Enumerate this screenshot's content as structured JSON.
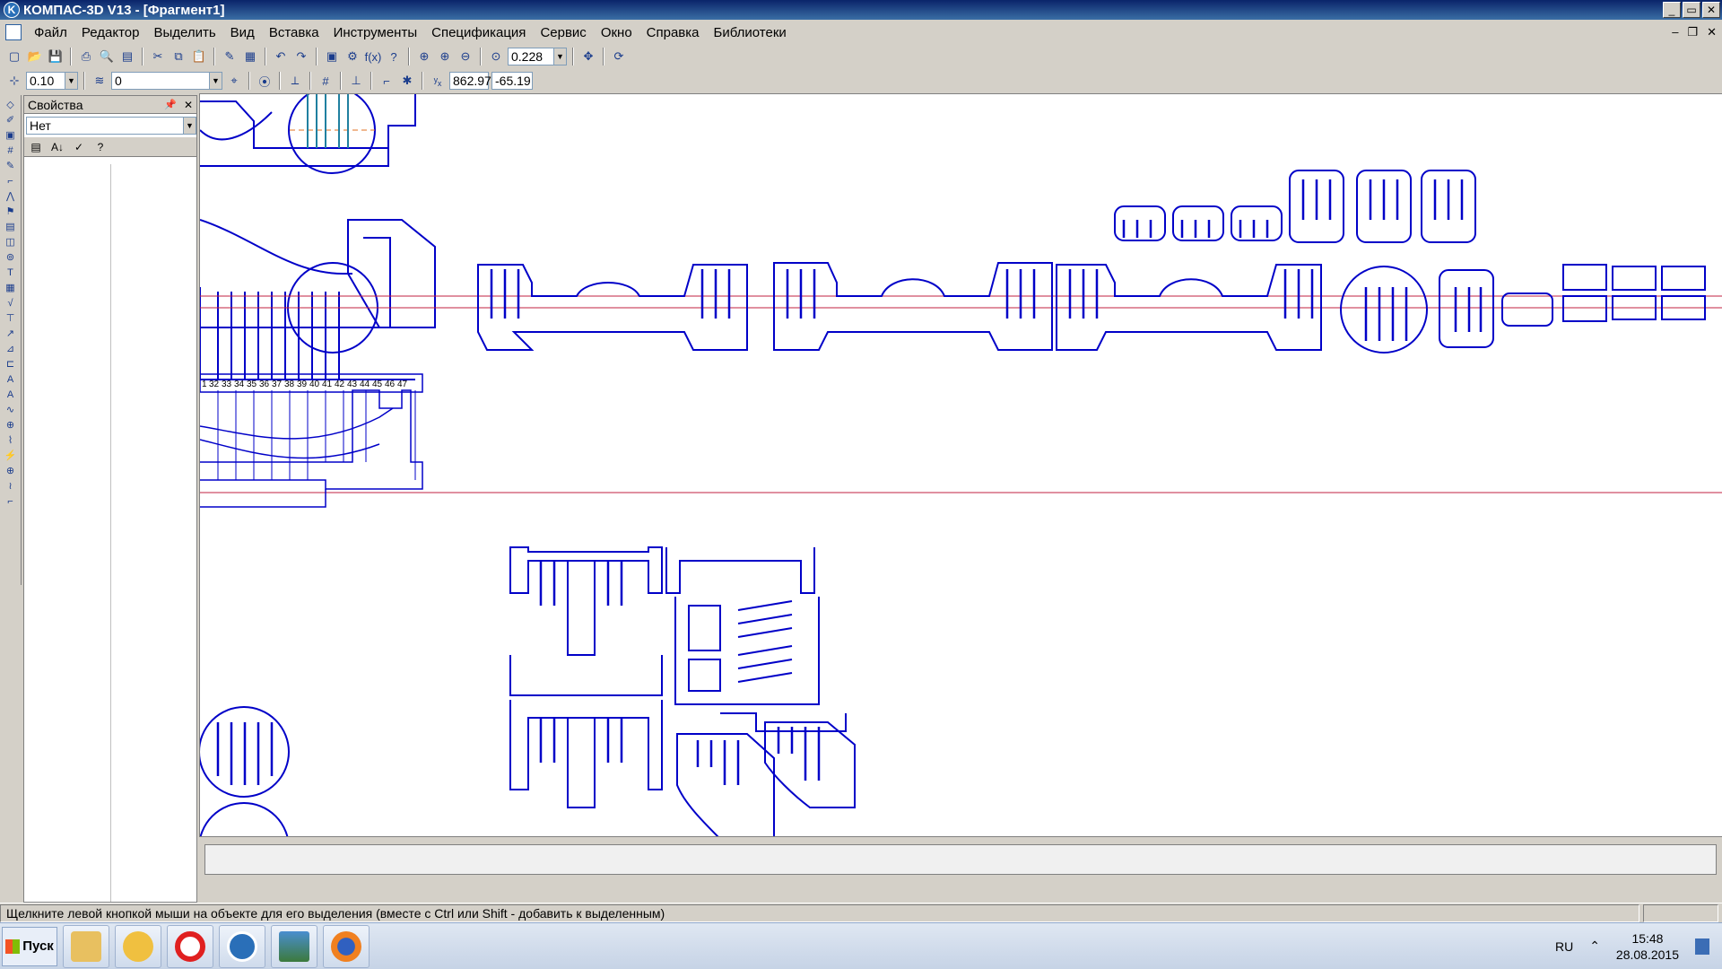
{
  "window": {
    "title": "КОМПАС-3D V13 - [Фрагмент1]"
  },
  "menu": [
    "Файл",
    "Редактор",
    "Выделить",
    "Вид",
    "Вставка",
    "Инструменты",
    "Спецификация",
    "Сервис",
    "Окно",
    "Справка",
    "Библиотеки"
  ],
  "toolbar": {
    "zoom_value": "0.228",
    "step_value": "0.10",
    "layer_value": "0",
    "coord_x": "862.97",
    "coord_y": "-65.19"
  },
  "properties": {
    "title": "Свойства",
    "selector_value": "Нет"
  },
  "canvas": {
    "column_numbers": [
      "1",
      "32",
      "33",
      "34",
      "35",
      "36",
      "37",
      "38",
      "39",
      "40",
      "41",
      "42",
      "43",
      "44",
      "45",
      "46",
      "47"
    ]
  },
  "status": {
    "message": "Щелкните левой кнопкой мыши на объекте для его выделения (вместе с Ctrl или Shift - добавить к выделенным)"
  },
  "taskbar": {
    "start_label": "Пуск",
    "language": "RU",
    "time": "15:48",
    "date": "28.08.2015"
  },
  "colors": {
    "drawing_line": "#0000c8",
    "axis_line": "#c02040",
    "title_gradient_start": "#0a246a"
  }
}
